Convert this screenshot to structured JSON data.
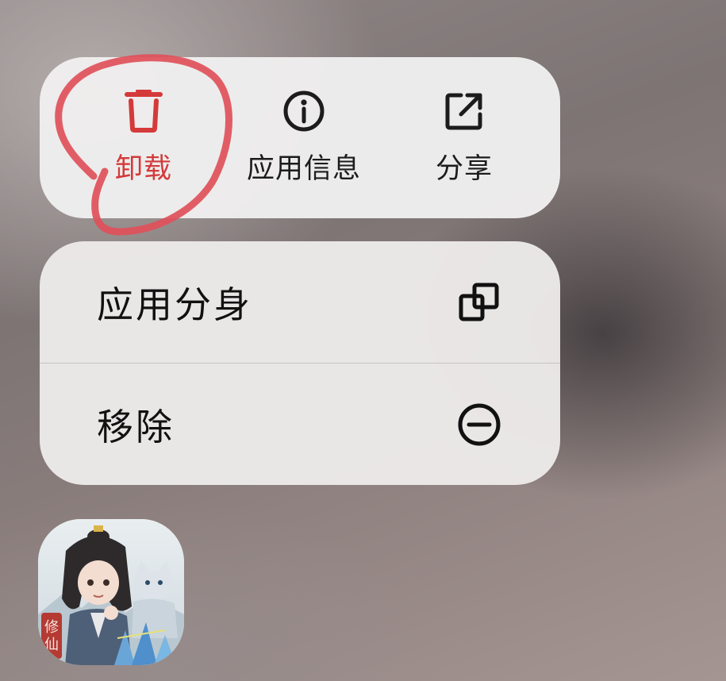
{
  "quick_actions": [
    {
      "id": "uninstall",
      "label": "卸载",
      "icon": "trash-icon",
      "color": "#d43a3a"
    },
    {
      "id": "app-info",
      "label": "应用信息",
      "icon": "info-icon",
      "color": "#1c1c1c"
    },
    {
      "id": "share",
      "label": "分享",
      "icon": "share-icon",
      "color": "#1c1c1c"
    }
  ],
  "menu": {
    "items": [
      {
        "id": "app-clone",
        "label": "应用分身",
        "icon": "app-clone-icon"
      },
      {
        "id": "remove",
        "label": "移除",
        "icon": "remove-minus-icon"
      }
    ]
  },
  "app": {
    "icon": "game-app-icon"
  },
  "annotation": {
    "color": "#e0505a",
    "target": "uninstall"
  }
}
